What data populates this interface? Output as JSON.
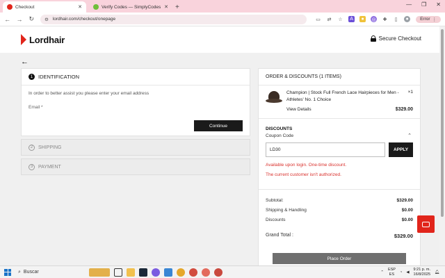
{
  "browser": {
    "tabs": [
      {
        "label": "Checkout",
        "active": true,
        "color": "#e1251b"
      },
      {
        "label": "Verify Codes — SimplyCodes",
        "active": false,
        "color": "#6fbf3a"
      }
    ],
    "url": "lordhair.com/checkout/onepage",
    "error_label": "Error"
  },
  "header": {
    "logo_text": "Lordhair",
    "secure_label": "Secure Checkout"
  },
  "identification": {
    "step": "1",
    "title": "IDENTIFICATION",
    "hint": "In order to better assist you please enter your email address",
    "email_label": "Email *",
    "continue_label": "Continue"
  },
  "steps": [
    {
      "num": "2",
      "label": "SHIPPING"
    },
    {
      "num": "3",
      "label": "PAYMENT"
    }
  ],
  "order": {
    "title": "ORDER & DISCOUNTS (1 ITEMS)",
    "item_name": "Champion | Stock Full French Lace Hairpieces for Men - Athletes' No. 1 Choice",
    "item_qty": "×1",
    "view_details": "View Details",
    "item_price": "$329.00"
  },
  "discounts": {
    "title": "DISCOUNTS",
    "coupon_label": "Coupon Code",
    "coupon_value": "LD30",
    "apply_label": "APPLY",
    "error1": "Available upon login. One-time discount.",
    "error2": "The current customer isn't authorized."
  },
  "totals": {
    "subtotal_label": "Subtotal:",
    "subtotal_value": "$329.00",
    "shipping_label": "Shipping & Handling",
    "shipping_value": "$0.00",
    "discounts_label": "Discounts",
    "discounts_value": "$0.00",
    "grand_label": "Grand Total :",
    "grand_value": "$329.00"
  },
  "place_order_label": "Place Order",
  "taskbar": {
    "search_label": "Buscar",
    "lang_top": "ESP",
    "lang_bottom": "ES",
    "time": "9:21 p. m.",
    "date": "16/8/2025"
  },
  "colors": {
    "brand": "#e1251b",
    "error": "#d9302c",
    "button_dark": "#1a1a1a"
  }
}
